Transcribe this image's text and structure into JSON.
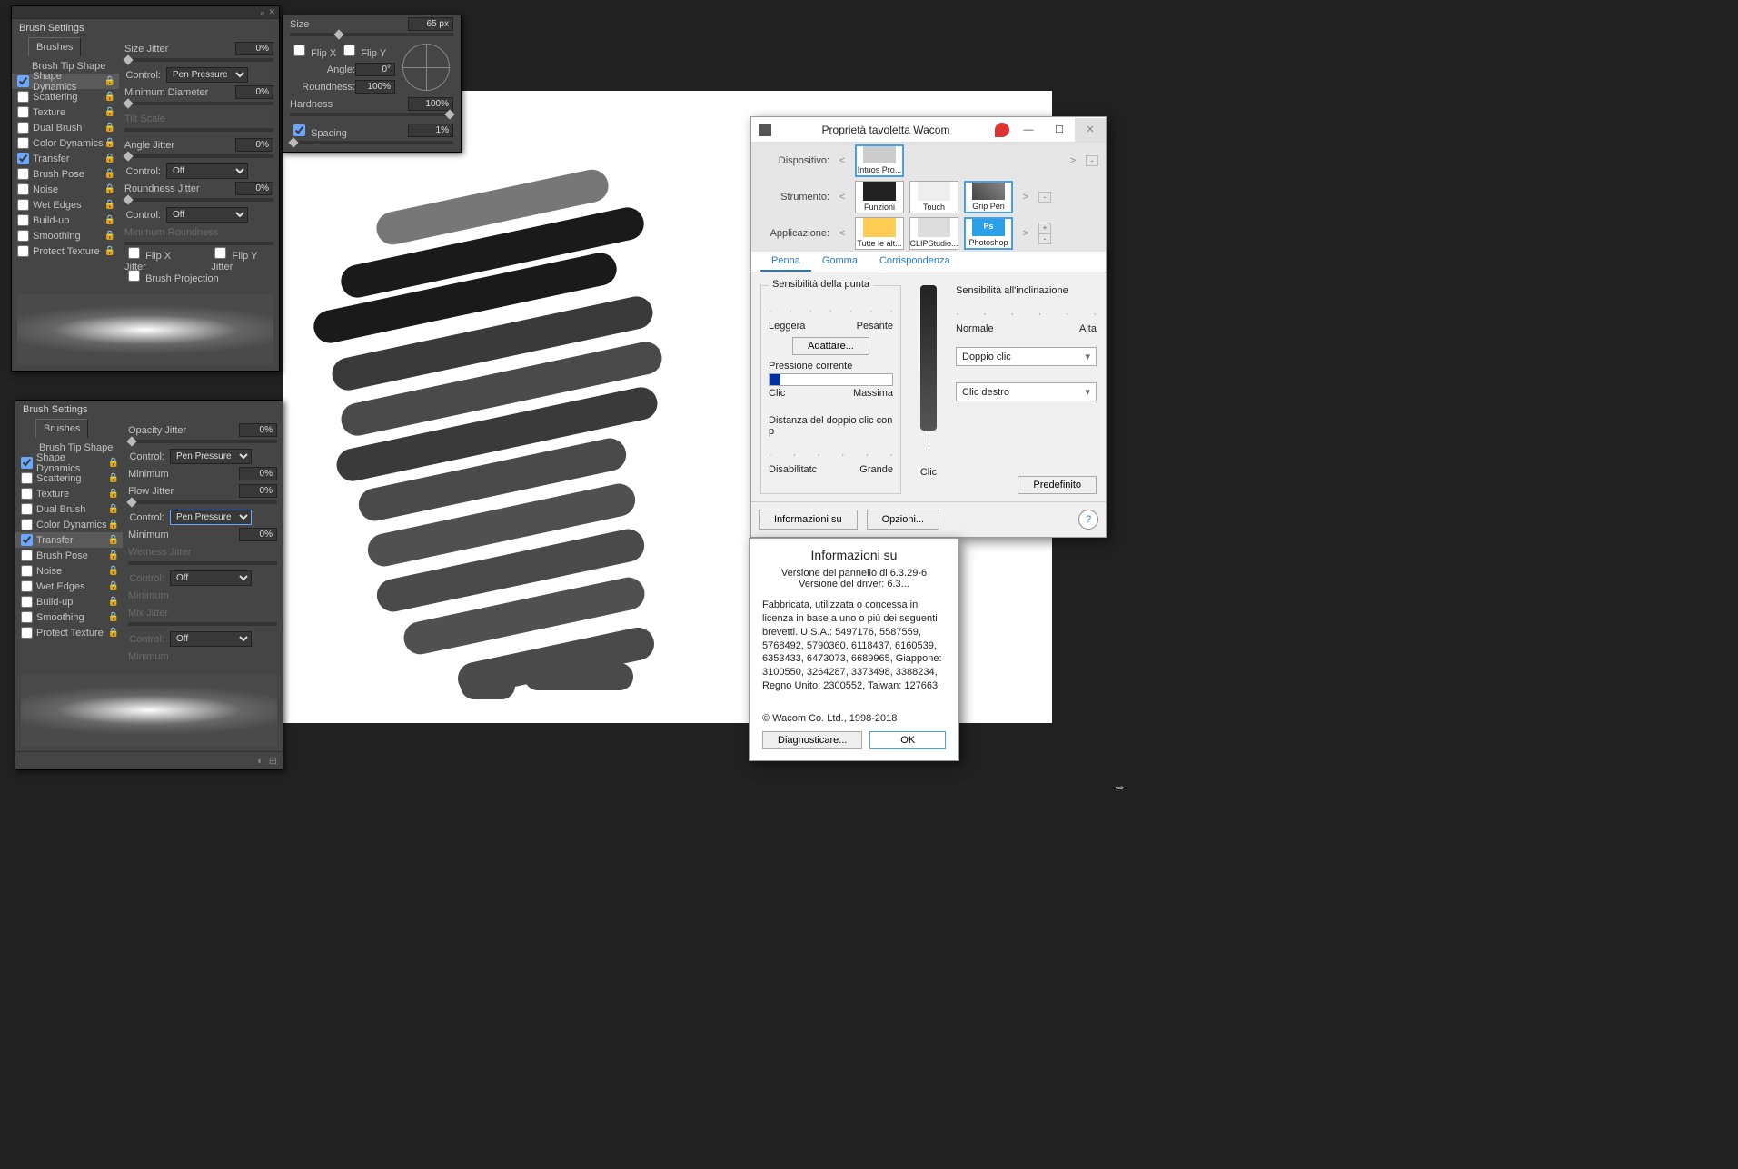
{
  "panel1": {
    "title": "Brush Settings",
    "brushes_tab": "Brushes",
    "tip_shape_tab": "Brush Tip Shape",
    "options": [
      {
        "label": "Shape Dynamics",
        "checked": true,
        "selected": true
      },
      {
        "label": "Scattering",
        "checked": false
      },
      {
        "label": "Texture",
        "checked": false
      },
      {
        "label": "Dual Brush",
        "checked": false
      },
      {
        "label": "Color Dynamics",
        "checked": false
      },
      {
        "label": "Transfer",
        "checked": true
      },
      {
        "label": "Brush Pose",
        "checked": false
      },
      {
        "label": "Noise",
        "checked": false
      },
      {
        "label": "Wet Edges",
        "checked": false
      },
      {
        "label": "Build-up",
        "checked": false
      },
      {
        "label": "Smoothing",
        "checked": false
      },
      {
        "label": "Protect Texture",
        "checked": false
      }
    ],
    "rows": {
      "size_jitter": "Size Jitter",
      "size_jitter_v": "0%",
      "control": "Control:",
      "control1_v": "Pen Pressure",
      "min_diam": "Minimum Diameter",
      "min_diam_v": "0%",
      "tilt_scale": "Tilt Scale",
      "angle_jitter": "Angle Jitter",
      "angle_jitter_v": "0%",
      "control2_v": "Off",
      "roundness_jitter": "Roundness Jitter",
      "roundness_jitter_v": "0%",
      "control3_v": "Off",
      "min_round": "Minimum Roundness",
      "flip_x": "Flip X Jitter",
      "flip_y": "Flip Y Jitter",
      "brush_proj": "Brush Projection"
    }
  },
  "tipPanel": {
    "size": "Size",
    "size_v": "65 px",
    "flip_x": "Flip X",
    "flip_y": "Flip Y",
    "angle": "Angle:",
    "angle_v": "0°",
    "roundness": "Roundness:",
    "roundness_v": "100%",
    "hardness": "Hardness",
    "hardness_v": "100%",
    "spacing": "Spacing",
    "spacing_v": "1%"
  },
  "panel2": {
    "title": "Brush Settings",
    "brushes_tab": "Brushes",
    "tip_shape_tab": "Brush Tip Shape",
    "options": [
      {
        "label": "Shape Dynamics",
        "checked": true
      },
      {
        "label": "Scattering",
        "checked": false
      },
      {
        "label": "Texture",
        "checked": false
      },
      {
        "label": "Dual Brush",
        "checked": false
      },
      {
        "label": "Color Dynamics",
        "checked": false
      },
      {
        "label": "Transfer",
        "checked": true,
        "selected": true
      },
      {
        "label": "Brush Pose",
        "checked": false
      },
      {
        "label": "Noise",
        "checked": false
      },
      {
        "label": "Wet Edges",
        "checked": false
      },
      {
        "label": "Build-up",
        "checked": false
      },
      {
        "label": "Smoothing",
        "checked": false
      },
      {
        "label": "Protect Texture",
        "checked": false
      }
    ],
    "rows": {
      "opacity_jitter": "Opacity Jitter",
      "opacity_jitter_v": "0%",
      "control": "Control:",
      "control1_v": "Pen Pressure",
      "minimum": "Minimum",
      "minimum1_v": "0%",
      "flow_jitter": "Flow Jitter",
      "flow_jitter_v": "0%",
      "control2_v": "Pen Pressure",
      "minimum2_v": "0%",
      "wetness": "Wetness Jitter",
      "control3_v": "Off",
      "minimum3": "Minimum",
      "mix": "Mix Jitter",
      "control4_v": "Off",
      "minimum4": "Minimum"
    }
  },
  "wacom": {
    "title": "Proprietà tavoletta Wacom",
    "device_lbl": "Dispositivo:",
    "device": "Intuos Pro...",
    "tool_lbl": "Strumento:",
    "tools": [
      "Funzioni",
      "Touch",
      "Grip Pen"
    ],
    "app_lbl": "Applicazione:",
    "apps": [
      "Tutte le alt...",
      "CLIPStudio...",
      "Photoshop"
    ],
    "tabs": {
      "pen": "Penna",
      "eraser": "Gomma",
      "mapping": "Corrispondenza"
    },
    "tip_sens": "Sensibilità della punta",
    "soft": "Leggera",
    "firm": "Pesante",
    "adjust": "Adattare...",
    "current_pressure": "Pressione corrente",
    "click": "Clic",
    "max": "Massima",
    "dbl_dist": "Distanza del doppio clic con p",
    "disabled": "Disabilitatc",
    "large": "Grande",
    "tilt_sens": "Sensibilità all'inclinazione",
    "normal": "Normale",
    "high": "Alta",
    "upper_btn": "Doppio clic",
    "lower_btn": "Clic destro",
    "clic_mark": "Clic",
    "default_btn": "Predefinito",
    "info_btn": "Informazioni su",
    "options_btn": "Opzioni...",
    "help": "?",
    "nav_prev": "<",
    "nav_next": ">",
    "plus": "+",
    "minus": "-"
  },
  "about": {
    "title": "Informazioni su",
    "panel_ver": "Versione del pannello di 6.3.29-6",
    "driver_ver": "Versione del driver: 6.3...",
    "legal": "Fabbricata, utilizzata o concessa in licenza in base a uno o più dei seguenti brevetti. U.S.A.: 5497176, 5587559, 5768492, 5790360, 6118437, 6160539, 6353433, 6473073, 6689965, Giappone: 3100550, 3264287, 3373498, 3388234, Regno Unito: 2300552, Taiwan: 127663,",
    "copyright": "© Wacom Co. Ltd., 1998-2018",
    "diagnose": "Diagnosticare...",
    "ok": "OK"
  }
}
